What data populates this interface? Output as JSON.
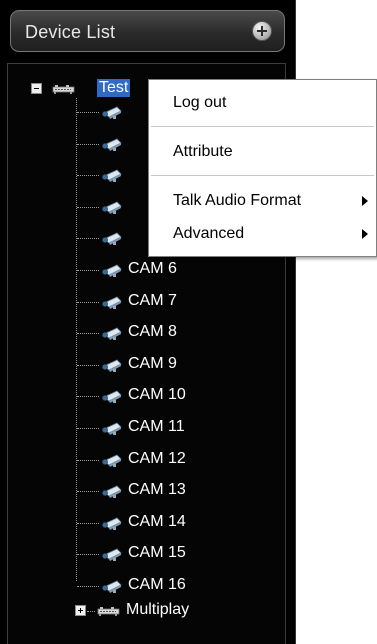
{
  "panel": {
    "title": "Device List",
    "add_icon": "plus-circle-icon"
  },
  "tree": {
    "root_device": {
      "label": "Test",
      "icon": "network-device-icon",
      "expanded": true,
      "selected": true,
      "cameras": [
        {
          "label": "CAM 6",
          "icon": "camera-icon"
        },
        {
          "label": "CAM 7",
          "icon": "camera-icon"
        },
        {
          "label": "CAM 8",
          "icon": "camera-icon"
        },
        {
          "label": "CAM 9",
          "icon": "camera-icon"
        },
        {
          "label": "CAM 10",
          "icon": "camera-icon"
        },
        {
          "label": "CAM 11",
          "icon": "camera-icon"
        },
        {
          "label": "CAM 12",
          "icon": "camera-icon"
        },
        {
          "label": "CAM 13",
          "icon": "camera-icon"
        },
        {
          "label": "CAM 14",
          "icon": "camera-icon"
        },
        {
          "label": "CAM 15",
          "icon": "camera-icon"
        },
        {
          "label": "CAM 16",
          "icon": "camera-icon"
        }
      ]
    },
    "second_device": {
      "label": "Multiplay",
      "icon": "network-device-icon",
      "expanded": false
    }
  },
  "context_menu": {
    "items": [
      {
        "label": "Log out"
      },
      {
        "label": "Attribute"
      },
      {
        "label": "Talk Audio Format",
        "submenu": true
      },
      {
        "label": "Advanced",
        "submenu": true
      }
    ]
  },
  "colors": {
    "selection": "#316ac5",
    "panel_bg": "#000000",
    "menu_bg": "#ffffff"
  }
}
